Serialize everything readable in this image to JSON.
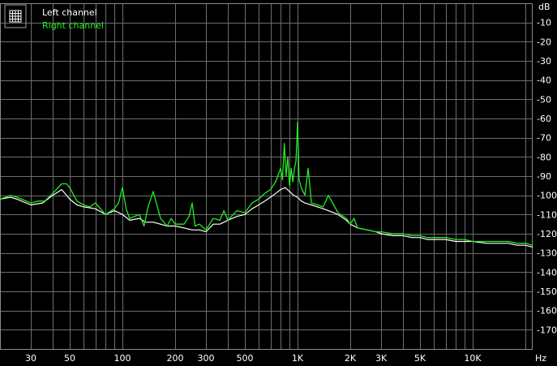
{
  "chart_data": {
    "type": "line",
    "xscale": "log",
    "xlim": [
      20,
      22000
    ],
    "ylim": [
      -180,
      0
    ],
    "grid": true,
    "legend_position": "top-left",
    "y_unit": "dB",
    "x_unit": "Hz",
    "x_ticks": [
      {
        "value": 30,
        "label": "30"
      },
      {
        "value": 50,
        "label": "50"
      },
      {
        "value": 100,
        "label": "100"
      },
      {
        "value": 200,
        "label": "200"
      },
      {
        "value": 300,
        "label": "300"
      },
      {
        "value": 500,
        "label": "500"
      },
      {
        "value": 1000,
        "label": "1K"
      },
      {
        "value": 2000,
        "label": "2K"
      },
      {
        "value": 3000,
        "label": "3K"
      },
      {
        "value": 5000,
        "label": "5K"
      },
      {
        "value": 10000,
        "label": "10K"
      }
    ],
    "y_ticks": [
      {
        "value": -10,
        "label": "-10"
      },
      {
        "value": -20,
        "label": "-20"
      },
      {
        "value": -30,
        "label": "-30"
      },
      {
        "value": -40,
        "label": "-40"
      },
      {
        "value": -50,
        "label": "-50"
      },
      {
        "value": -60,
        "label": "-60"
      },
      {
        "value": -70,
        "label": "-70"
      },
      {
        "value": -80,
        "label": "-80"
      },
      {
        "value": -90,
        "label": "-90"
      },
      {
        "value": -100,
        "label": "-100"
      },
      {
        "value": -110,
        "label": "-110"
      },
      {
        "value": -120,
        "label": "-120"
      },
      {
        "value": -130,
        "label": "-130"
      },
      {
        "value": -140,
        "label": "-140"
      },
      {
        "value": -150,
        "label": "-150"
      },
      {
        "value": -160,
        "label": "-160"
      },
      {
        "value": -170,
        "label": "-170"
      }
    ],
    "series": [
      {
        "name": "Left channel",
        "color": "#ffffff",
        "x": [
          20,
          23,
          25,
          30,
          35,
          40,
          45,
          50,
          55,
          60,
          70,
          80,
          90,
          100,
          110,
          125,
          135,
          150,
          165,
          180,
          200,
          225,
          250,
          275,
          300,
          330,
          360,
          400,
          450,
          500,
          550,
          600,
          650,
          700,
          750,
          800,
          850,
          900,
          950,
          1000,
          1050,
          1100,
          1200,
          1300,
          1400,
          1500,
          1700,
          1900,
          2000,
          2200,
          2500,
          2800,
          3000,
          3500,
          4000,
          4500,
          5000,
          5500,
          6000,
          7000,
          8000,
          9000,
          10000,
          12000,
          14000,
          16000,
          18000,
          20000,
          22000
        ],
        "y": [
          -102,
          -101,
          -102,
          -105,
          -104,
          -100,
          -97,
          -102,
          -105,
          -106,
          -107,
          -110,
          -108,
          -110,
          -113,
          -112,
          -114,
          -114,
          -115,
          -116,
          -116,
          -117,
          -118,
          -118,
          -119,
          -115,
          -115,
          -113,
          -111,
          -110,
          -107,
          -105,
          -103,
          -101,
          -99,
          -97,
          -96,
          -98,
          -100,
          -101,
          -103,
          -104,
          -105,
          -106,
          -107,
          -108,
          -110,
          -113,
          -115,
          -117,
          -118,
          -119,
          -120,
          -121,
          -121,
          -122,
          -122,
          -123,
          -123,
          -123,
          -124,
          -124,
          -124,
          -125,
          -125,
          -125,
          -126,
          -126,
          -127
        ]
      },
      {
        "name": "Right channel",
        "color": "#22ee22",
        "x": [
          20,
          23,
          25,
          30,
          33,
          36,
          40,
          45,
          48,
          50,
          55,
          60,
          65,
          70,
          75,
          80,
          90,
          95,
          100,
          105,
          110,
          125,
          133,
          140,
          150,
          165,
          180,
          190,
          200,
          225,
          240,
          250,
          260,
          275,
          300,
          330,
          360,
          380,
          400,
          450,
          500,
          550,
          600,
          650,
          700,
          750,
          800,
          820,
          840,
          860,
          880,
          900,
          920,
          940,
          960,
          980,
          1000,
          1020,
          1050,
          1100,
          1150,
          1200,
          1300,
          1400,
          1500,
          1700,
          1900,
          2000,
          2100,
          2200,
          2500,
          2800,
          3000,
          3500,
          4000,
          4500,
          5000,
          5500,
          6000,
          7000,
          8000,
          9000,
          10000,
          12000,
          14000,
          16000,
          18000,
          20000,
          22000
        ],
        "y": [
          -102,
          -100,
          -101,
          -104,
          -103,
          -103,
          -99,
          -94,
          -94,
          -96,
          -103,
          -105,
          -106,
          -104,
          -107,
          -110,
          -107,
          -104,
          -96,
          -107,
          -112,
          -110,
          -116,
          -106,
          -98,
          -112,
          -116,
          -112,
          -115,
          -115,
          -111,
          -104,
          -116,
          -115,
          -118,
          -112,
          -113,
          -108,
          -113,
          -108,
          -109,
          -104,
          -102,
          -99,
          -97,
          -93,
          -86,
          -92,
          -73,
          -90,
          -80,
          -95,
          -86,
          -93,
          -86,
          -82,
          -62,
          -92,
          -96,
          -100,
          -86,
          -104,
          -105,
          -106,
          -100,
          -109,
          -112,
          -115,
          -112,
          -117,
          -118,
          -119,
          -119,
          -120,
          -120,
          -121,
          -121,
          -122,
          -122,
          -122,
          -123,
          -123,
          -124,
          -124,
          -124,
          -124,
          -125,
          -125,
          -126
        ]
      }
    ]
  }
}
